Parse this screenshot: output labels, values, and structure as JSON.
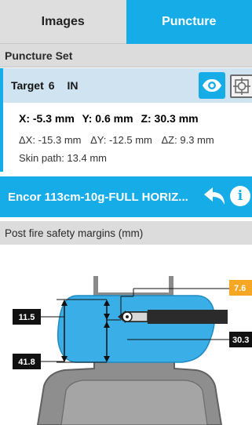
{
  "tabs": [
    {
      "label": "Images",
      "active": false
    },
    {
      "label": "Puncture",
      "active": true
    }
  ],
  "colors": {
    "accent": "#16ace8",
    "header_bg": "#dcdcdc",
    "target_row_bg": "#cfe3f1",
    "lesion": "#3aaee6",
    "margin_orange": "#f5a623"
  },
  "puncture_set": {
    "title": "Puncture Set",
    "target": {
      "label": "Target",
      "number": "6",
      "side": "IN"
    },
    "icons": {
      "visibility": "eye-icon",
      "target": "crosshair-target-icon"
    }
  },
  "coordinates": {
    "x": "X: -5.3 mm",
    "y": "Y: 0.6 mm",
    "z": "Z: 30.3 mm",
    "dx": "ΔX: -15.3 mm",
    "dy": "ΔY: -12.5 mm",
    "dz": "ΔZ: 9.3 mm",
    "skin_path": "Skin path: 13.4 mm"
  },
  "device": {
    "name": "Encor 113cm-10g-FULL HORIZ...",
    "icons": {
      "undo": "undo-arrow-icon",
      "info": "info-icon"
    },
    "info_glyph": "i"
  },
  "margins": {
    "title": "Post fire safety margins (mm)",
    "top_margin": "11.5",
    "bottom_margin": "41.8",
    "right_orange": "7.6",
    "right_depth": "30.3"
  }
}
